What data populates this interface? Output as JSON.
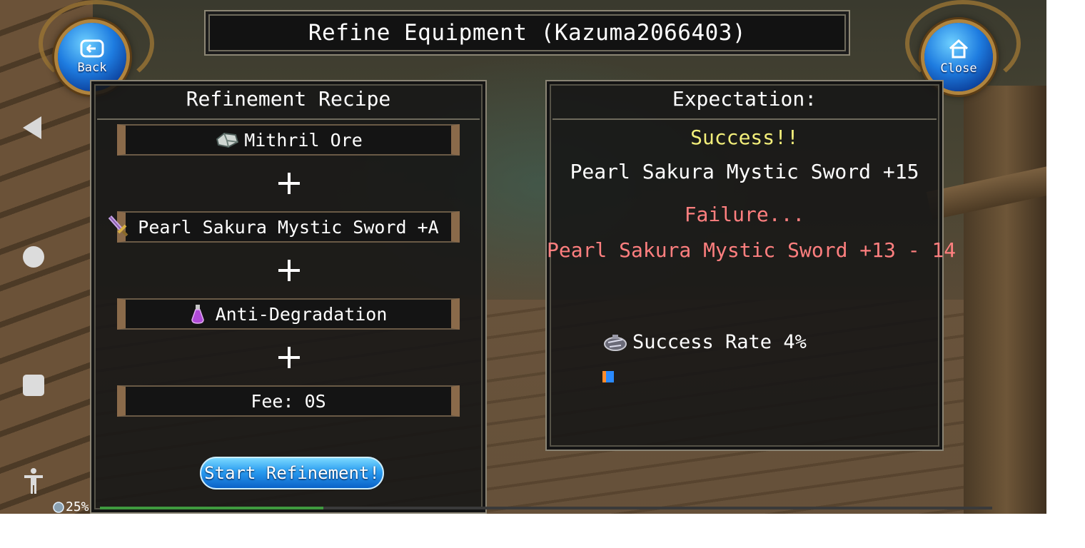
{
  "header": {
    "title": "Refine Equipment (Kazuma2066403)",
    "back_label": "Back",
    "close_label": "Close"
  },
  "recipe": {
    "heading": "Refinement Recipe",
    "items": [
      {
        "label": "Mithril Ore",
        "icon": "ore-icon"
      },
      {
        "label": "Pearl Sakura Mystic Sword +A",
        "icon": "sword-icon"
      },
      {
        "label": "Anti-Degradation",
        "icon": "potion-icon"
      },
      {
        "label": "Fee: 0S",
        "icon": ""
      }
    ],
    "start_label": "Start Refinement!"
  },
  "expectation": {
    "heading": "Expectation:",
    "success_label": "Success!!",
    "success_result": "Pearl Sakura Mystic Sword +15",
    "failure_label": "Failure...",
    "failure_result": "Pearl Sakura Mystic Sword +13 - 14",
    "success_rate_text": "Success Rate 4%",
    "success_rate_value": 4
  },
  "status": {
    "exp_percent_text": "25%",
    "exp_percent_value": 25
  },
  "colors": {
    "success": "#f2ee7a",
    "failure": "#ff7f7f",
    "button_blue": "#2a9cf0"
  }
}
